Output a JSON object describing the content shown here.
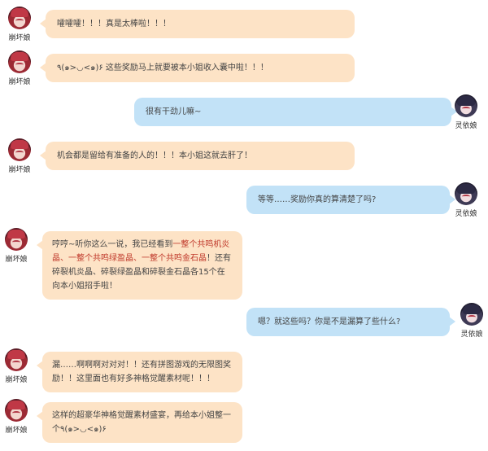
{
  "speakers": {
    "left": "崩坏娘",
    "right": "灵依娘"
  },
  "messages": [
    {
      "side": "left",
      "text": "嚯嚯嚯！！！真是太棒啦！！！"
    },
    {
      "side": "left",
      "text": "٩(๑>◡<๑)۶ 这些奖励马上就要被本小姐收入囊中啦！！！"
    },
    {
      "side": "right",
      "text": "很有干劲儿嘛~"
    },
    {
      "side": "left",
      "text": "机会都是留给有准备的人的！！！本小姐这就去肝了！"
    },
    {
      "side": "right",
      "text": "等等……奖励你真的算清楚了吗?"
    },
    {
      "side": "left",
      "parts": [
        "哼哼~听你这么一说，我已经看到",
        "一整个共鸣机炎晶、一整个共鸣绿盈晶、一整个共鸣金石晶",
        "！还有碎裂机炎晶、碎裂绿盈晶和碎裂金石晶各15个在向本小姐招手啦！"
      ]
    },
    {
      "side": "right",
      "text": "嗯？就这些吗？你是不是漏算了些什么?"
    },
    {
      "side": "left",
      "text": "漏……啊啊啊对对对！！还有拼图游戏的无限图奖励！！这里面也有好多神格觉醒素材呢！！！"
    },
    {
      "side": "left",
      "text": "这样的超豪华神格觉醒素材盛宴，再给本小姐整一个٩(๑>◡<๑)۶"
    }
  ]
}
